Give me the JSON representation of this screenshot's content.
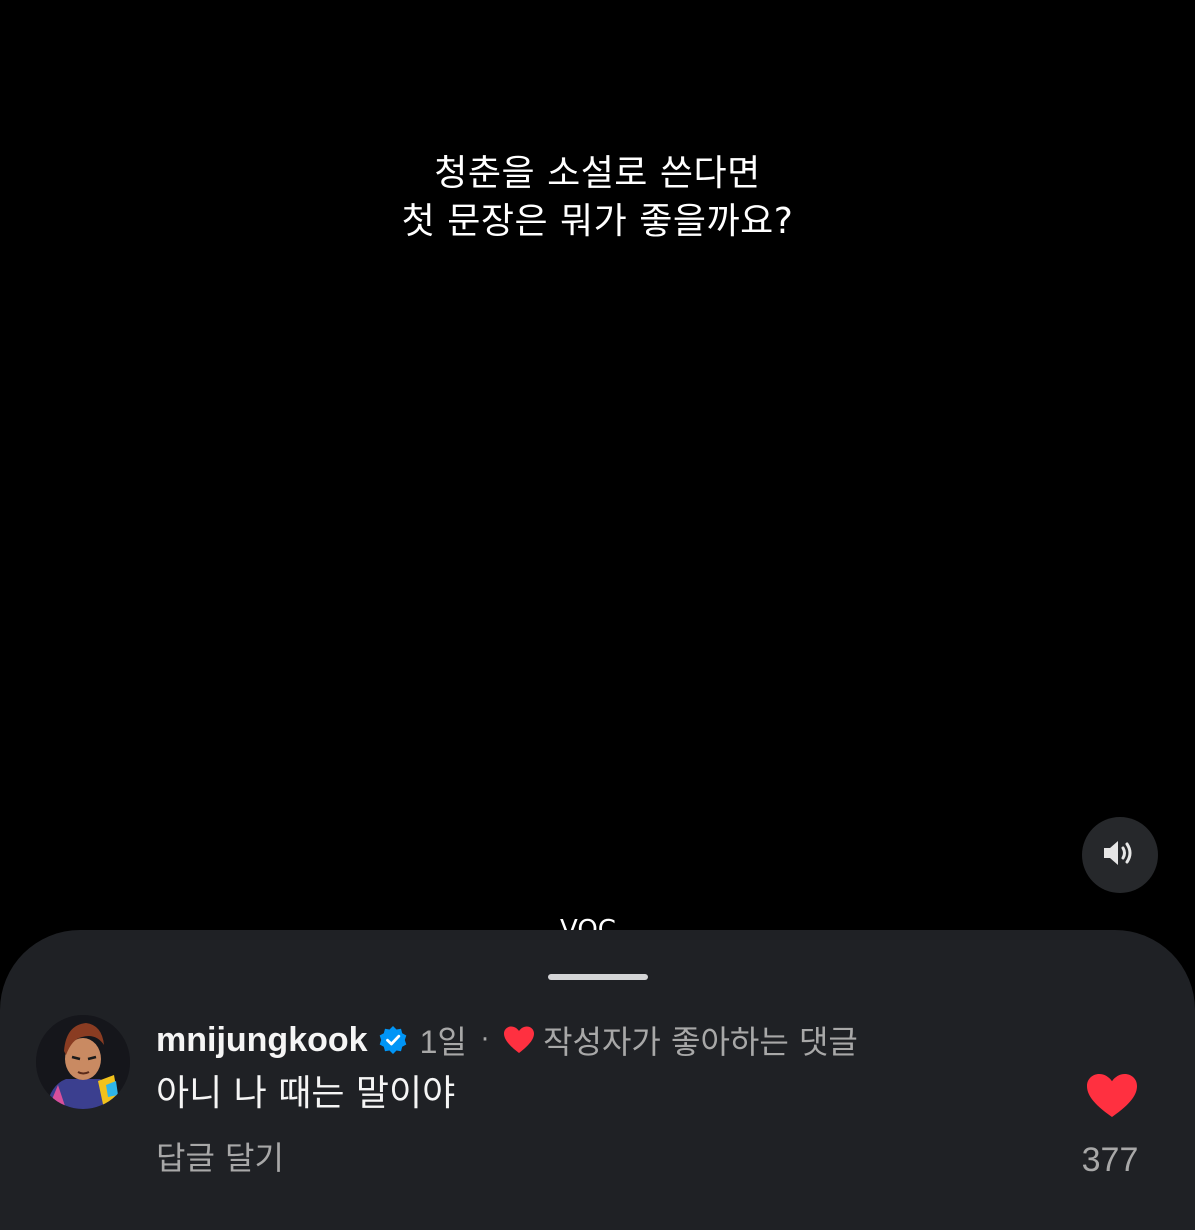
{
  "post": {
    "caption_line1": "청춘을 소설로 쓴다면",
    "caption_line2": "첫 문장은 뭐가 좋을까요?",
    "peek_text": "VOC"
  },
  "controls": {
    "volume_icon": "speaker-volume-icon"
  },
  "comment": {
    "username": "mnijungkook",
    "verified": true,
    "time": "1일",
    "separator": "·",
    "liked_by_author_label": "작성자가 좋아하는 댓글",
    "text": "아니 나 때는 말이야",
    "reply_label": "답글 달기",
    "like_count": "377",
    "liked": true
  },
  "colors": {
    "background": "#000000",
    "sheet": "#1f2125",
    "heart": "#ff3040",
    "verified": "#0095f6",
    "secondary_text": "#a8a8a8"
  }
}
